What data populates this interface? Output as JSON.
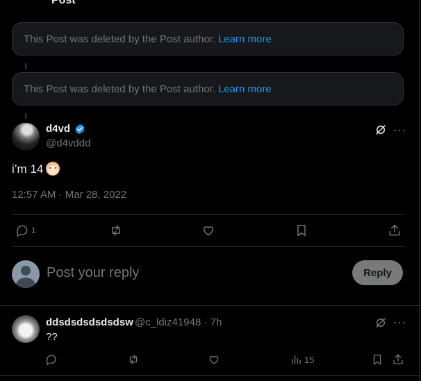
{
  "top_partial_text": "Post",
  "deleted_notices": [
    {
      "text": "This Post was deleted by the Post author.",
      "link": "Learn more"
    },
    {
      "text": "This Post was deleted by the Post author.",
      "link": "Learn more"
    }
  ],
  "main_post": {
    "display_name": "d4vd",
    "handle": "@d4vddd",
    "text": "i’m 14",
    "timestamp": "12:57 AM · Mar 28, 2022",
    "reply_count": "1",
    "more_label": "···"
  },
  "composer": {
    "placeholder": "Post your reply",
    "reply_button": "Reply"
  },
  "reply": {
    "display_name": "ddsdsdsdsdsdsw",
    "handle_time": "@c_ldiz41948 · 7h",
    "text": "??",
    "views": "15",
    "more_label": "···"
  },
  "colors": {
    "background": "#000000",
    "link": "#1d9bf0",
    "verified": "#1d9bf0",
    "muted_text": "#71767b",
    "reply_button_bg": "#787a7a"
  }
}
